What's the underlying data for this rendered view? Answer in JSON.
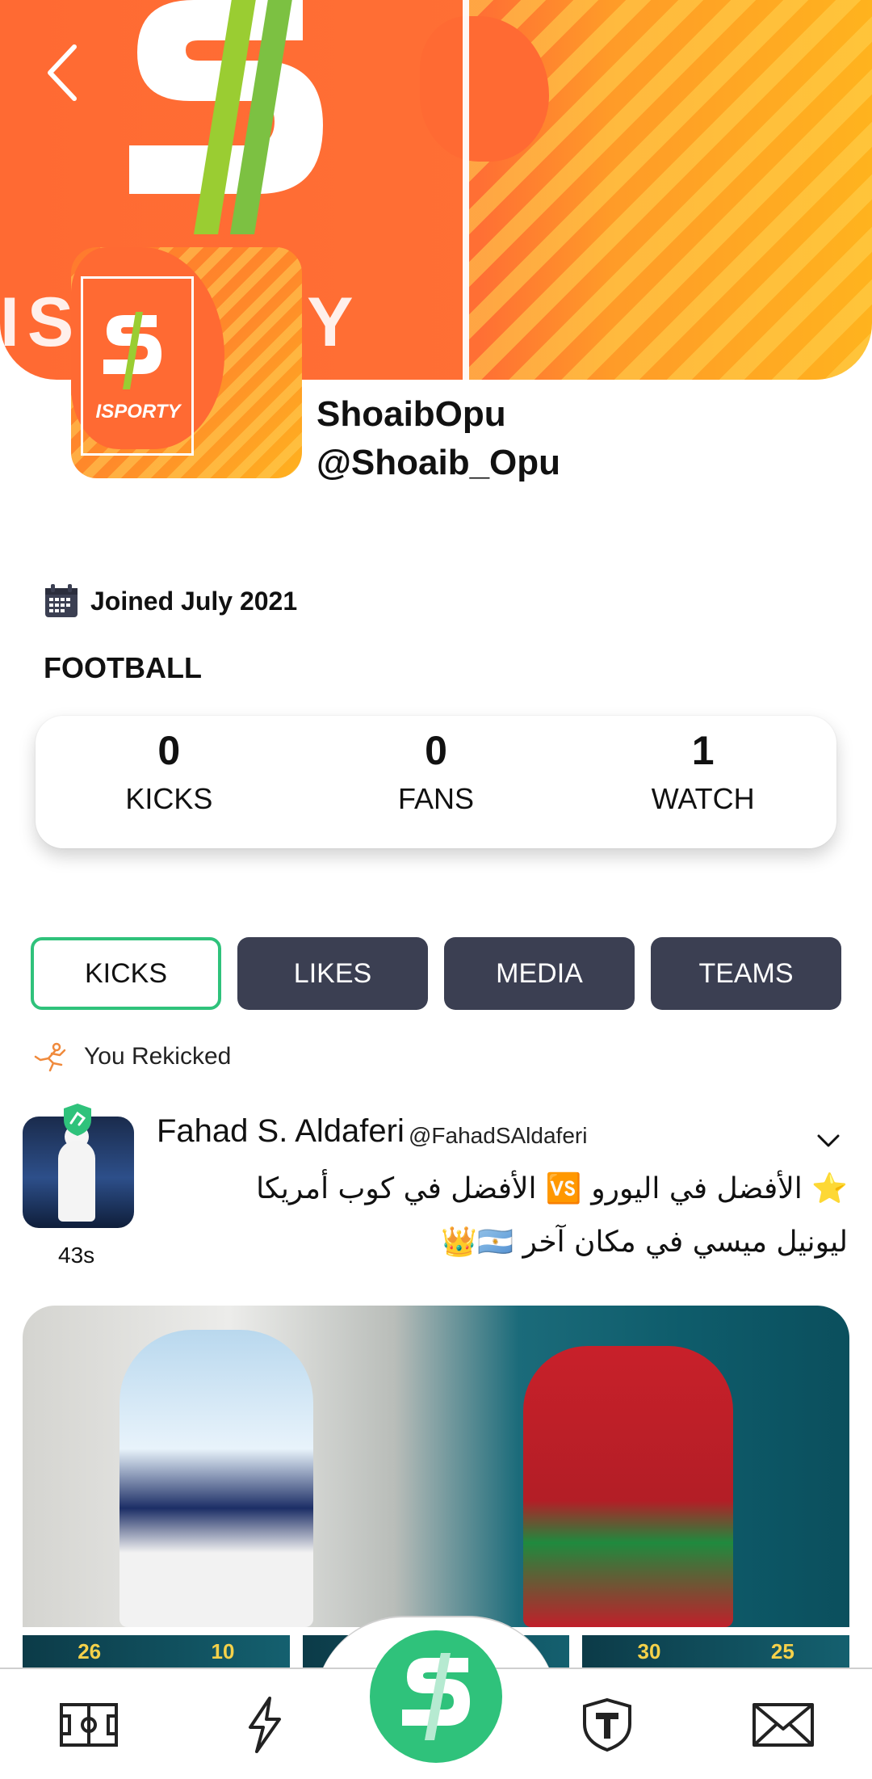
{
  "header": {
    "banner_logo_text": "ISPORTY",
    "back_icon": "chevron-left-icon",
    "colors": {
      "brand_orange": "#ff6a33",
      "brand_green": "#2fc27b",
      "lime": "#9acd32"
    }
  },
  "profile": {
    "avatar_text": "ISPORTY",
    "display_name": "ShoaibOpu",
    "handle": "@Shoaib_Opu",
    "joined": "Joined July 2021",
    "sport": "FOOTBALL"
  },
  "stats": [
    {
      "value": "0",
      "label": "KICKS"
    },
    {
      "value": "0",
      "label": "FANS"
    },
    {
      "value": "1",
      "label": "WATCH"
    }
  ],
  "tabs": [
    {
      "label": "KICKS",
      "active": true
    },
    {
      "label": "LIKES",
      "active": false
    },
    {
      "label": "MEDIA",
      "active": false
    },
    {
      "label": "TEAMS",
      "active": false
    }
  ],
  "activity": {
    "label": "You Rekicked",
    "icon": "rekick-icon"
  },
  "post": {
    "author_name": "Fahad S. Aldaferi",
    "author_handle": "@FahadSAldaferi",
    "time": "43s",
    "line1": "⭐️ الأفضل في اليورو 🆚 الأفضل في كوب أمريكا",
    "line2": "ليونيل ميسي في مكان آخر 🇦🇷👑",
    "thumbnail_numbers": [
      "26",
      "10",
      "30",
      "25"
    ]
  },
  "bottom_nav": [
    {
      "name": "pitch-icon"
    },
    {
      "name": "lightning-icon"
    },
    {
      "name": "isporty-logo-button"
    },
    {
      "name": "shield-t-icon"
    },
    {
      "name": "mail-icon"
    }
  ]
}
